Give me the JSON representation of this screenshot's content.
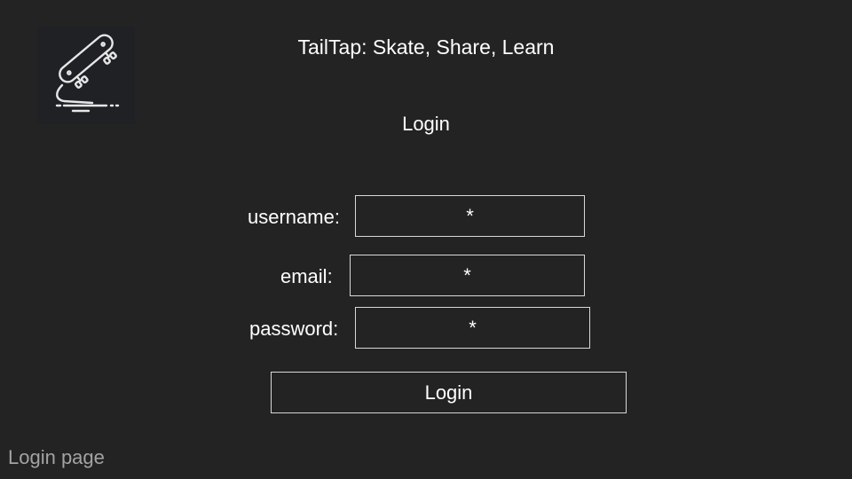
{
  "app": {
    "title": "TailTap: Skate, Share, Learn",
    "logo_icon": "skateboard-icon"
  },
  "login": {
    "heading": "Login",
    "fields": [
      {
        "label": "username:",
        "placeholder": "*"
      },
      {
        "label": "email:",
        "placeholder": "*"
      },
      {
        "label": "password:",
        "placeholder": "*"
      }
    ],
    "button_label": "Login"
  },
  "footer": {
    "caption": "Login page"
  },
  "colors": {
    "background": "#232323",
    "text": "#ffffff",
    "border": "#d8d8d8",
    "caption": "#a3a3a3"
  }
}
